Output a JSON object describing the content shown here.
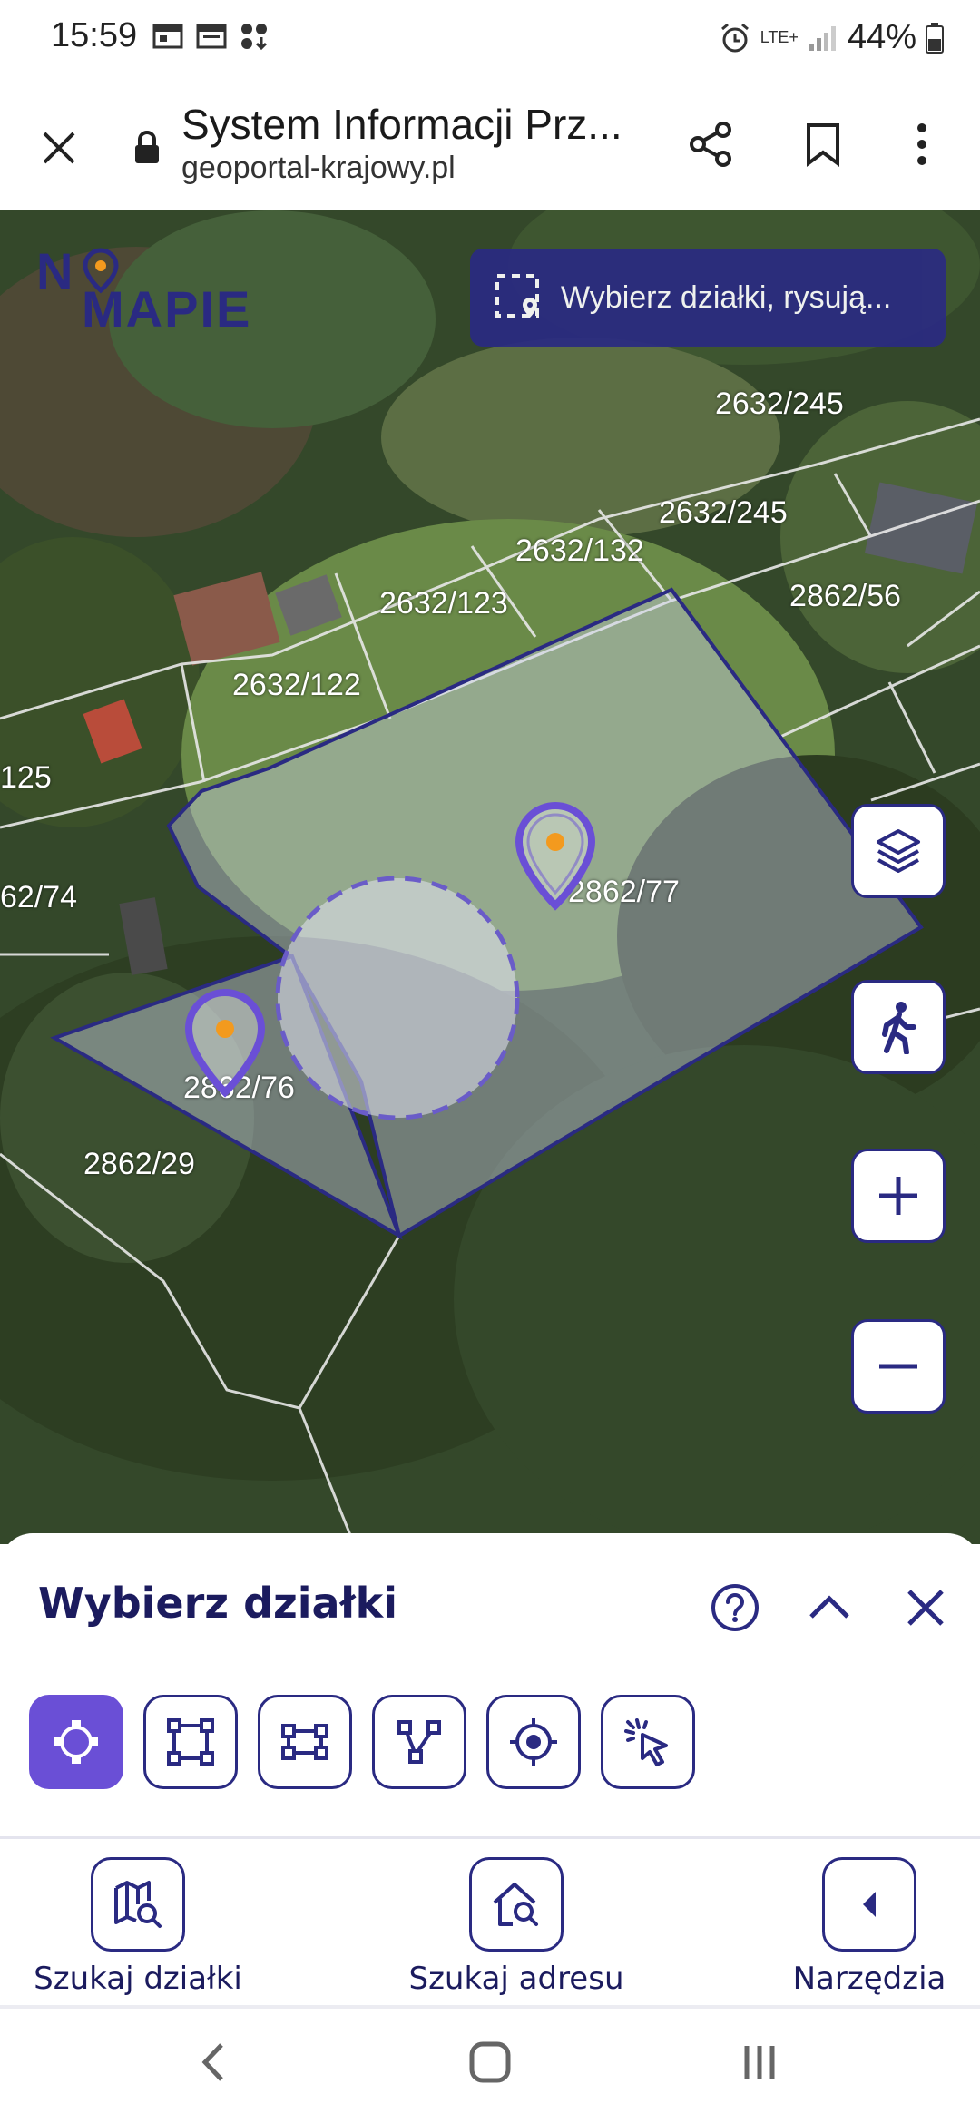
{
  "status_bar": {
    "time": "15:59",
    "network": "LTE+",
    "battery": "44%"
  },
  "browser": {
    "title": "System Informacji Prz...",
    "url": "geoportal-krajowy.pl"
  },
  "map": {
    "logo_part1": "N",
    "logo_part2": "MAPIE",
    "search_chip_text": "Wybierz działki, rysują...",
    "parcels": {
      "p1": "2632/245",
      "p2": "2632/245",
      "p3": "2632/132",
      "p4": "2632/123",
      "p5": "2862/56",
      "p6": "2632/122",
      "p7": "125",
      "p8": "62/74",
      "p9": "2862/77",
      "p10": "2862/76",
      "p11": "2862/29"
    }
  },
  "panel": {
    "title": "Wybierz działki"
  },
  "bottom_nav": {
    "search_parcel": "Szukaj działki",
    "search_address": "Szukaj adresu",
    "tools": "Narzędzia"
  },
  "colors": {
    "accent": "#2a2a82",
    "active": "#6a4fd6",
    "pin_orange": "#f39a1e"
  }
}
